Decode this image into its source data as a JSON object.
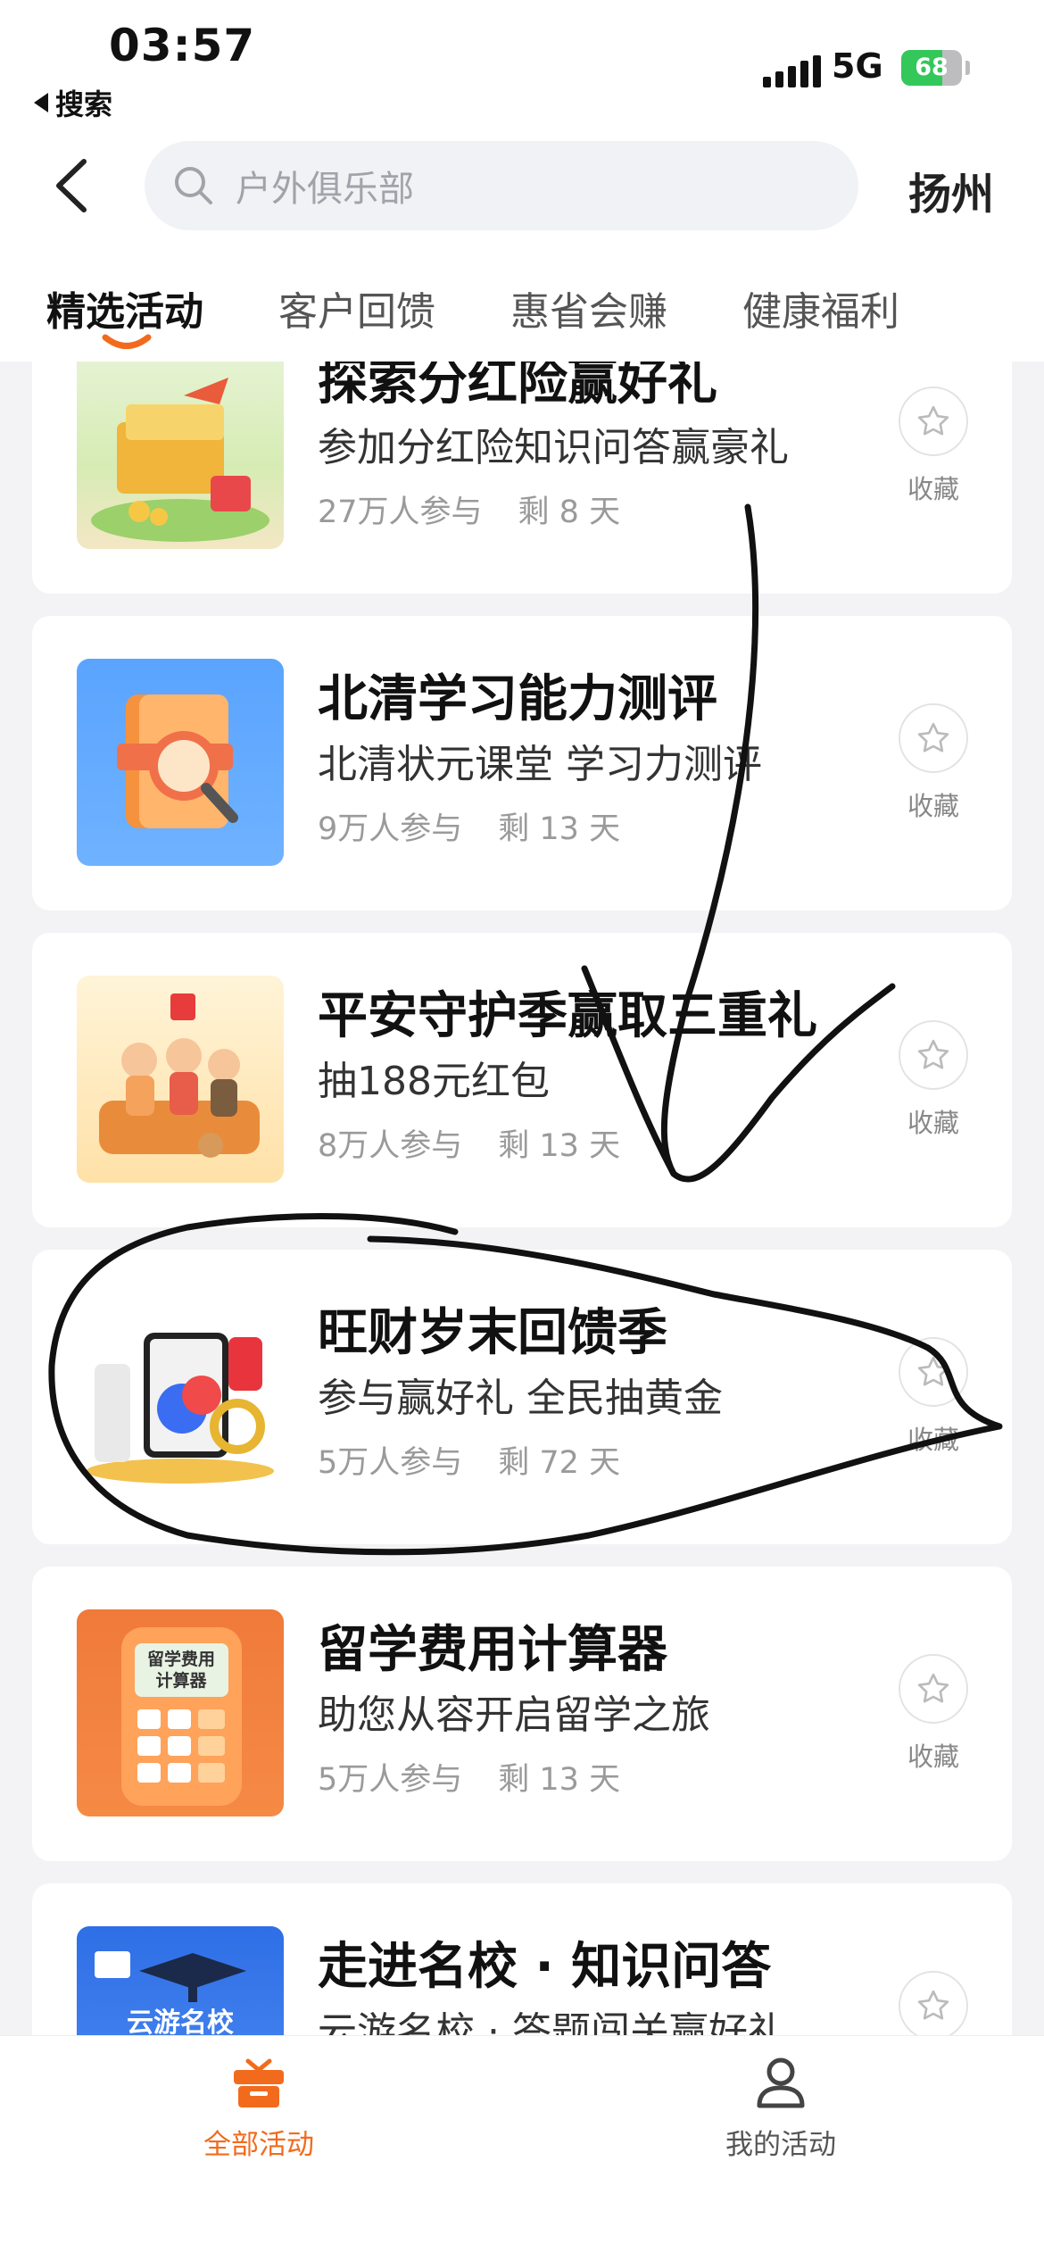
{
  "status_bar": {
    "time": "03:57",
    "back_app_label": "搜索",
    "network": "5G",
    "battery": "68",
    "battery_level": 0.68
  },
  "header": {
    "search_placeholder": "户外俱乐部",
    "city": "扬州"
  },
  "tabs": [
    {
      "label": "精选活动",
      "active": true
    },
    {
      "label": "客户回馈",
      "active": false
    },
    {
      "label": "惠省会赚",
      "active": false
    },
    {
      "label": "健康福利",
      "active": false
    }
  ],
  "activities": [
    {
      "title": "探索分红险赢好礼",
      "desc": "参加分红险知识问答赢豪礼",
      "participants": "27万人参与",
      "remaining": "剩 8 天",
      "fav_label": "收藏"
    },
    {
      "title": "北清学习能力测评",
      "desc": "北清状元课堂 学习力测评",
      "participants": "9万人参与",
      "remaining": "剩 13 天",
      "fav_label": "收藏"
    },
    {
      "title": "平安守护季赢取三重礼",
      "desc": "抽188元红包",
      "participants": "8万人参与",
      "remaining": "剩 13 天",
      "fav_label": "收藏"
    },
    {
      "title": "旺财岁末回馈季",
      "desc": "参与赢好礼 全民抽黄金",
      "participants": "5万人参与",
      "remaining": "剩 72 天",
      "fav_label": "收藏"
    },
    {
      "title": "留学费用计算器",
      "desc": "助您从容开启留学之旅",
      "participants": "5万人参与",
      "remaining": "剩 13 天",
      "fav_label": "收藏",
      "thumb_text": "留学费用\n计算器"
    },
    {
      "title": "走进名校 · 知识问答",
      "desc": "云游名校 · 答题闯关赢好礼",
      "participants": "",
      "remaining": "",
      "fav_label": "收藏",
      "thumb_text": "云游名校"
    }
  ],
  "bottom_nav": {
    "all_label": "全部活动",
    "mine_label": "我的活动"
  },
  "colors": {
    "accent": "#f26b1d",
    "battery_green": "#34c759"
  }
}
